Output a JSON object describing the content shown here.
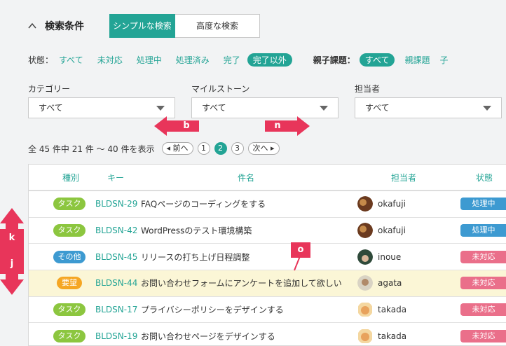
{
  "header": {
    "title": "検索条件",
    "tab_simple": "シンプルな検索",
    "tab_advanced": "高度な検索"
  },
  "status_filter": {
    "label": "状態：",
    "options": [
      "すべて",
      "未対応",
      "処理中",
      "処理済み",
      "完了"
    ],
    "selected": "完了以外",
    "parent_label": "親子課題：",
    "parent_selected": "すべて",
    "parent_options": [
      "親課題",
      "子"
    ]
  },
  "filters": {
    "category": {
      "label": "カテゴリー",
      "value": "すべて"
    },
    "milestone": {
      "label": "マイルストーン",
      "value": "すべて"
    },
    "assignee": {
      "label": "担当者",
      "value": "すべて"
    }
  },
  "markers": {
    "b": "b",
    "n": "n",
    "k": "k",
    "j": "j",
    "o": "o"
  },
  "pager": {
    "summary": "全 45 件中 21 件 〜 40 件を表示",
    "prev": "◂ 前へ",
    "pages": [
      "1",
      "2",
      "3"
    ],
    "current": "2",
    "next": "次へ ▸"
  },
  "table": {
    "headers": {
      "type": "種別",
      "key": "キー",
      "subject": "件名",
      "assignee": "担当者",
      "status": "状態"
    },
    "rows": [
      {
        "type": "タスク",
        "key": "BLDSN-29",
        "subject": "FAQページのコーディングをする",
        "assignee": "okafuji",
        "status": "処理中"
      },
      {
        "type": "タスク",
        "key": "BLDSN-42",
        "subject": "WordPressのテスト環境構築",
        "assignee": "okafuji",
        "status": "処理中"
      },
      {
        "type": "その他",
        "key": "BLDSN-45",
        "subject": "リリースの打ち上げ日程調整",
        "assignee": "inoue",
        "status": "未対応"
      },
      {
        "type": "要望",
        "key": "BLDSN-44",
        "subject": "お問い合わせフォームにアンケートを追加して欲しい",
        "assignee": "agata",
        "status": "未対応"
      },
      {
        "type": "タスク",
        "key": "BLDSN-17",
        "subject": "プライバシーポリシーをデザインする",
        "assignee": "takada",
        "status": "未対応"
      },
      {
        "type": "タスク",
        "key": "BLDSN-19",
        "subject": "お問い合わせページをデザインする",
        "assignee": "takada",
        "status": "未対応"
      }
    ]
  },
  "colors": {
    "accent": "#23a495",
    "task": "#8cc63f",
    "other": "#3d9ad1",
    "request": "#f5a623",
    "in_progress": "#3d9ad1",
    "open": "#ea6f8a",
    "marker": "#e8355a"
  }
}
